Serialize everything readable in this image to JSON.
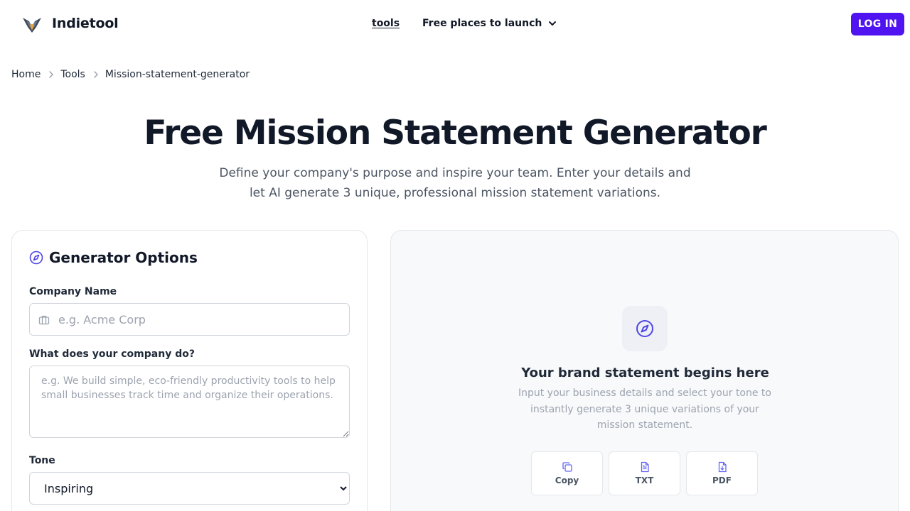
{
  "header": {
    "brand": "Indietool",
    "nav_tools": "tools",
    "nav_free_places": "Free places to launch",
    "login_label": "LOG IN"
  },
  "breadcrumb": {
    "items": [
      "Home",
      "Tools",
      "Mission-statement-generator"
    ]
  },
  "hero": {
    "title": "Free Mission Statement Generator",
    "subtitle": "Define your company's purpose and inspire your team. Enter your details and let AI generate 3 unique, professional mission statement variations."
  },
  "options": {
    "title": "Generator Options",
    "company_name_label": "Company Name",
    "company_name_placeholder": "e.g. Acme Corp",
    "company_name_value": "",
    "what_label": "What does your company do?",
    "what_placeholder": "e.g. We build simple, eco-friendly productivity tools to help small businesses track time and organize their operations.",
    "tone_label": "Tone",
    "tone_value": "Inspiring"
  },
  "output": {
    "empty_title": "Your brand statement begins here",
    "empty_desc": "Input your business details and select your tone to instantly generate 3 unique variations of your mission statement.",
    "copy_label": "Copy",
    "txt_label": "TXT",
    "pdf_label": "PDF"
  },
  "colors": {
    "accent": "#4f14ef",
    "icon_accent": "#4f46e5"
  }
}
